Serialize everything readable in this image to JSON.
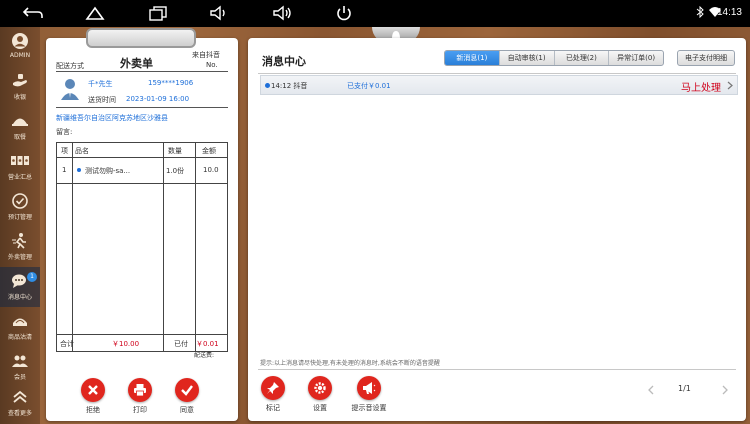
{
  "status_bar": {
    "time": "14:13"
  },
  "sidebar": {
    "items": [
      {
        "label": "ADMIN",
        "icon": "avatar-icon"
      },
      {
        "label": "收银",
        "icon": "cashier-icon"
      },
      {
        "label": "取餐",
        "icon": "dish-icon"
      },
      {
        "label": "营业汇总",
        "icon": "summary-icon"
      },
      {
        "label": "预订管理",
        "icon": "clock-icon"
      },
      {
        "label": "外卖管理",
        "icon": "delivery-icon"
      },
      {
        "label": "消息中心",
        "icon": "chat-icon",
        "badge": "1"
      },
      {
        "label": "商品沽清",
        "icon": "goods-icon"
      },
      {
        "label": "会员",
        "icon": "member-icon"
      },
      {
        "label": "查看更多",
        "icon": "more-icon"
      }
    ]
  },
  "ticket": {
    "delivery_label": "配送方式",
    "title": "外卖单",
    "source": "来自抖音",
    "no_label": "No.",
    "customer_name": "千*先生",
    "phone": "159****1906",
    "time_label": "送货时间",
    "time_value": "2023-01-09 16:00",
    "address": "新疆维吾尔自治区阿克苏地区沙雅县",
    "remark_label": "留言:",
    "table_headers": [
      "项",
      "品名",
      "数量",
      "金额"
    ],
    "rows": [
      {
        "index": "1",
        "name": "测试勿购-sa...",
        "qty": "1.0份",
        "amount": "10.0"
      }
    ],
    "total_label": "合计",
    "total_value": "￥10.00",
    "paid_label": "已付",
    "paid_value": "￥0.01",
    "delivery_fee_label": "配送费:",
    "actions": [
      {
        "label": "拒绝",
        "icon": "reject-icon"
      },
      {
        "label": "打印",
        "icon": "printer-icon"
      },
      {
        "label": "同意",
        "icon": "check-icon"
      }
    ]
  },
  "message_center": {
    "title": "消息中心",
    "tabs": [
      {
        "label": "新消息(1)",
        "active": true
      },
      {
        "label": "自动审核(1)",
        "active": false
      },
      {
        "label": "已处理(2)",
        "active": false
      },
      {
        "label": "异常订单(0)",
        "active": false
      }
    ],
    "payment_detail_label": "电子支付明细",
    "messages": [
      {
        "time_source": "14:12 抖音",
        "status": "已支付￥0.01",
        "action": "马上处理"
      }
    ],
    "hint": "提示:以上消息请尽快处理,有未处理的消息时,系统会不断的语音提醒",
    "bottom_actions": [
      {
        "label": "标记",
        "icon": "pin-icon"
      },
      {
        "label": "设置",
        "icon": "settings-icon"
      },
      {
        "label": "提示音设置",
        "icon": "megaphone-icon"
      }
    ],
    "pagination": "1/1"
  },
  "colors": {
    "accent_blue": "#2a7fd8",
    "action_red": "#e0261e",
    "money_red": "#d0021b",
    "paid_blue": "#1e6fd9"
  }
}
